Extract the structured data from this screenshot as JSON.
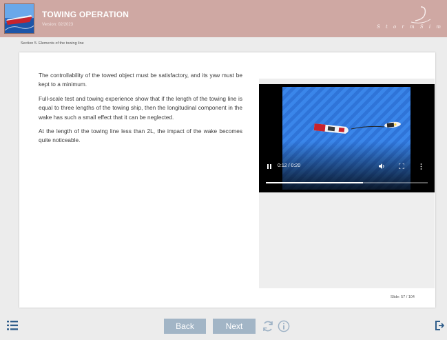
{
  "header": {
    "title": "TOWING OPERATION",
    "version": "Version: 02/2023",
    "brand_text": "S t o r m  S i m",
    "accent_color": "#cfa8a3"
  },
  "breadcrumb": "Section 5. Elements of the towing line",
  "content": {
    "paragraphs": [
      "The controllability of the towed object must be satisfactory, and its yaw must be kept to a minimum.",
      "Full-scale test and towing experience show that if the length of the towing line is equal to three lengths of the towing ship, then the longitudinal component in the wake has such a small effect that it can be neglected.",
      "At the length of the towing line less than 2L, the impact of the wake becomes quite noticeable."
    ]
  },
  "video": {
    "time": "0:12 / 0:20",
    "progress": 0.6,
    "icons": [
      "pause-icon",
      "volume-icon",
      "fullscreen-icon",
      "more-icon"
    ]
  },
  "slide_counter": "Slide: 57 / 104",
  "footer": {
    "back_label": "Back",
    "next_label": "Next",
    "button_color": "#a2b5c6",
    "icons": [
      "menu-list-icon",
      "replay-icon",
      "info-icon",
      "exit-icon"
    ]
  }
}
